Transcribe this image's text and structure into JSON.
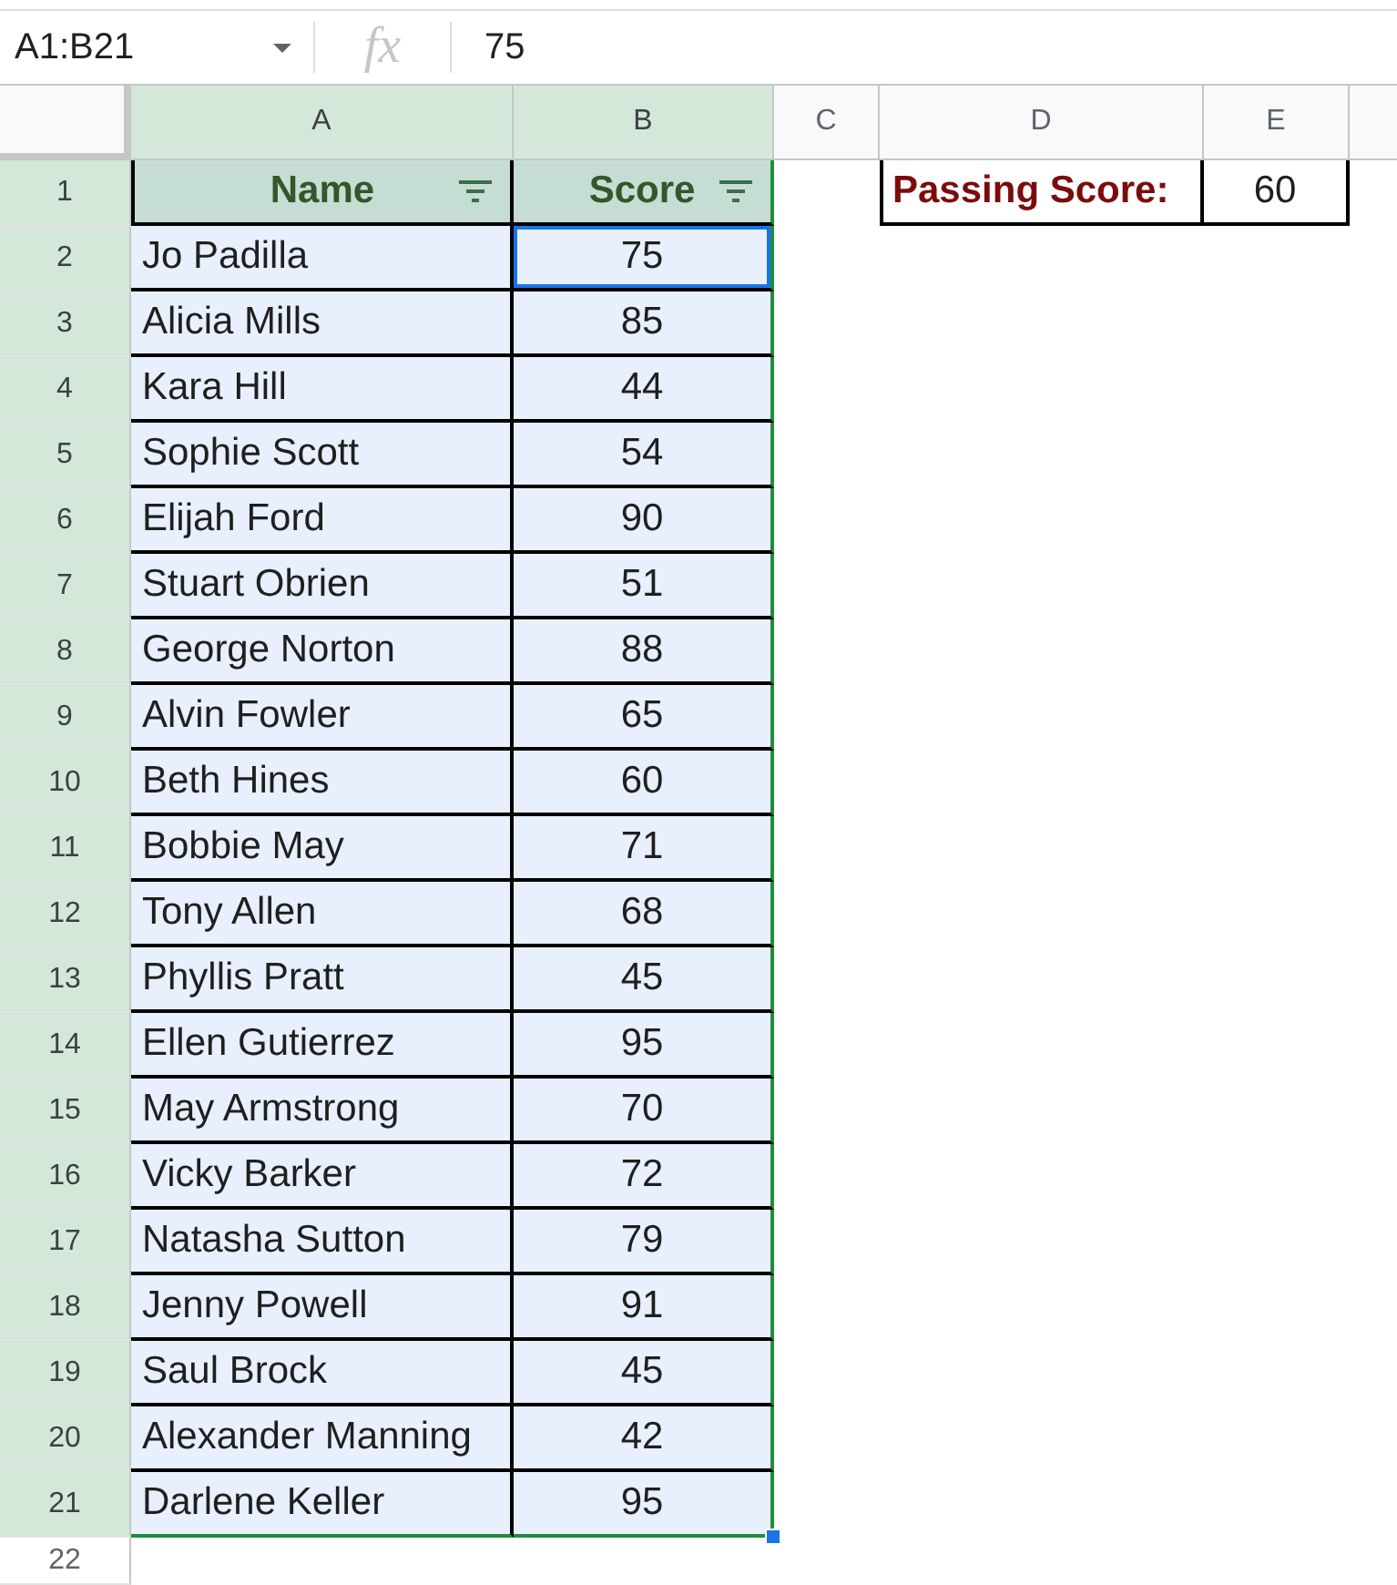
{
  "formula_bar": {
    "name_box": "A1:B21",
    "fx_label": "fx",
    "value": "75"
  },
  "column_headers": [
    {
      "label": "A",
      "selected": true
    },
    {
      "label": "B",
      "selected": true
    },
    {
      "label": "C",
      "selected": false
    },
    {
      "label": "D",
      "selected": false
    },
    {
      "label": "E",
      "selected": false
    }
  ],
  "row_headers": [
    {
      "label": "1",
      "selected": true
    },
    {
      "label": "2",
      "selected": true
    },
    {
      "label": "3",
      "selected": true
    },
    {
      "label": "4",
      "selected": true
    },
    {
      "label": "5",
      "selected": true
    },
    {
      "label": "6",
      "selected": true
    },
    {
      "label": "7",
      "selected": true
    },
    {
      "label": "8",
      "selected": true
    },
    {
      "label": "9",
      "selected": true
    },
    {
      "label": "10",
      "selected": true
    },
    {
      "label": "11",
      "selected": true
    },
    {
      "label": "12",
      "selected": true
    },
    {
      "label": "13",
      "selected": true
    },
    {
      "label": "14",
      "selected": true
    },
    {
      "label": "15",
      "selected": true
    },
    {
      "label": "16",
      "selected": true
    },
    {
      "label": "17",
      "selected": true
    },
    {
      "label": "18",
      "selected": true
    },
    {
      "label": "19",
      "selected": true
    },
    {
      "label": "20",
      "selected": true
    },
    {
      "label": "21",
      "selected": true
    },
    {
      "label": "22",
      "selected": false
    }
  ],
  "score_table": {
    "header": [
      {
        "label": "Name",
        "filter": true
      },
      {
        "label": "Score",
        "filter": true
      }
    ],
    "rows": [
      {
        "cells": [
          {
            "text": "Jo Padilla",
            "selected": false
          },
          {
            "text": "75",
            "selected": true
          }
        ]
      },
      {
        "cells": [
          {
            "text": "Alicia Mills",
            "selected": false
          },
          {
            "text": "85",
            "selected": false
          }
        ]
      },
      {
        "cells": [
          {
            "text": "Kara Hill",
            "selected": false
          },
          {
            "text": "44",
            "selected": false
          }
        ]
      },
      {
        "cells": [
          {
            "text": "Sophie Scott",
            "selected": false
          },
          {
            "text": "54",
            "selected": false
          }
        ]
      },
      {
        "cells": [
          {
            "text": "Elijah Ford",
            "selected": false
          },
          {
            "text": "90",
            "selected": false
          }
        ]
      },
      {
        "cells": [
          {
            "text": "Stuart Obrien",
            "selected": false
          },
          {
            "text": "51",
            "selected": false
          }
        ]
      },
      {
        "cells": [
          {
            "text": "George Norton",
            "selected": false
          },
          {
            "text": "88",
            "selected": false
          }
        ]
      },
      {
        "cells": [
          {
            "text": "Alvin Fowler",
            "selected": false
          },
          {
            "text": "65",
            "selected": false
          }
        ]
      },
      {
        "cells": [
          {
            "text": "Beth Hines",
            "selected": false
          },
          {
            "text": "60",
            "selected": false
          }
        ]
      },
      {
        "cells": [
          {
            "text": "Bobbie May",
            "selected": false
          },
          {
            "text": "71",
            "selected": false
          }
        ]
      },
      {
        "cells": [
          {
            "text": "Tony Allen",
            "selected": false
          },
          {
            "text": "68",
            "selected": false
          }
        ]
      },
      {
        "cells": [
          {
            "text": "Phyllis Pratt",
            "selected": false
          },
          {
            "text": "45",
            "selected": false
          }
        ]
      },
      {
        "cells": [
          {
            "text": "Ellen Gutierrez",
            "selected": false
          },
          {
            "text": "95",
            "selected": false
          }
        ]
      },
      {
        "cells": [
          {
            "text": "May Armstrong",
            "selected": false
          },
          {
            "text": "70",
            "selected": false
          }
        ]
      },
      {
        "cells": [
          {
            "text": "Vicky Barker",
            "selected": false
          },
          {
            "text": "72",
            "selected": false
          }
        ]
      },
      {
        "cells": [
          {
            "text": "Natasha Sutton",
            "selected": false
          },
          {
            "text": "79",
            "selected": false
          }
        ]
      },
      {
        "cells": [
          {
            "text": "Jenny Powell",
            "selected": false
          },
          {
            "text": "91",
            "selected": false
          }
        ]
      },
      {
        "cells": [
          {
            "text": "Saul Brock",
            "selected": false
          },
          {
            "text": "45",
            "selected": false
          }
        ]
      },
      {
        "cells": [
          {
            "text": "Alexander Manning",
            "selected": false
          },
          {
            "text": "42",
            "selected": false
          }
        ]
      },
      {
        "cells": [
          {
            "text": "Darlene Keller",
            "selected": false
          },
          {
            "text": "95",
            "selected": false
          }
        ]
      }
    ]
  },
  "passing_score": {
    "label": "Passing Score:",
    "value": "60"
  }
}
